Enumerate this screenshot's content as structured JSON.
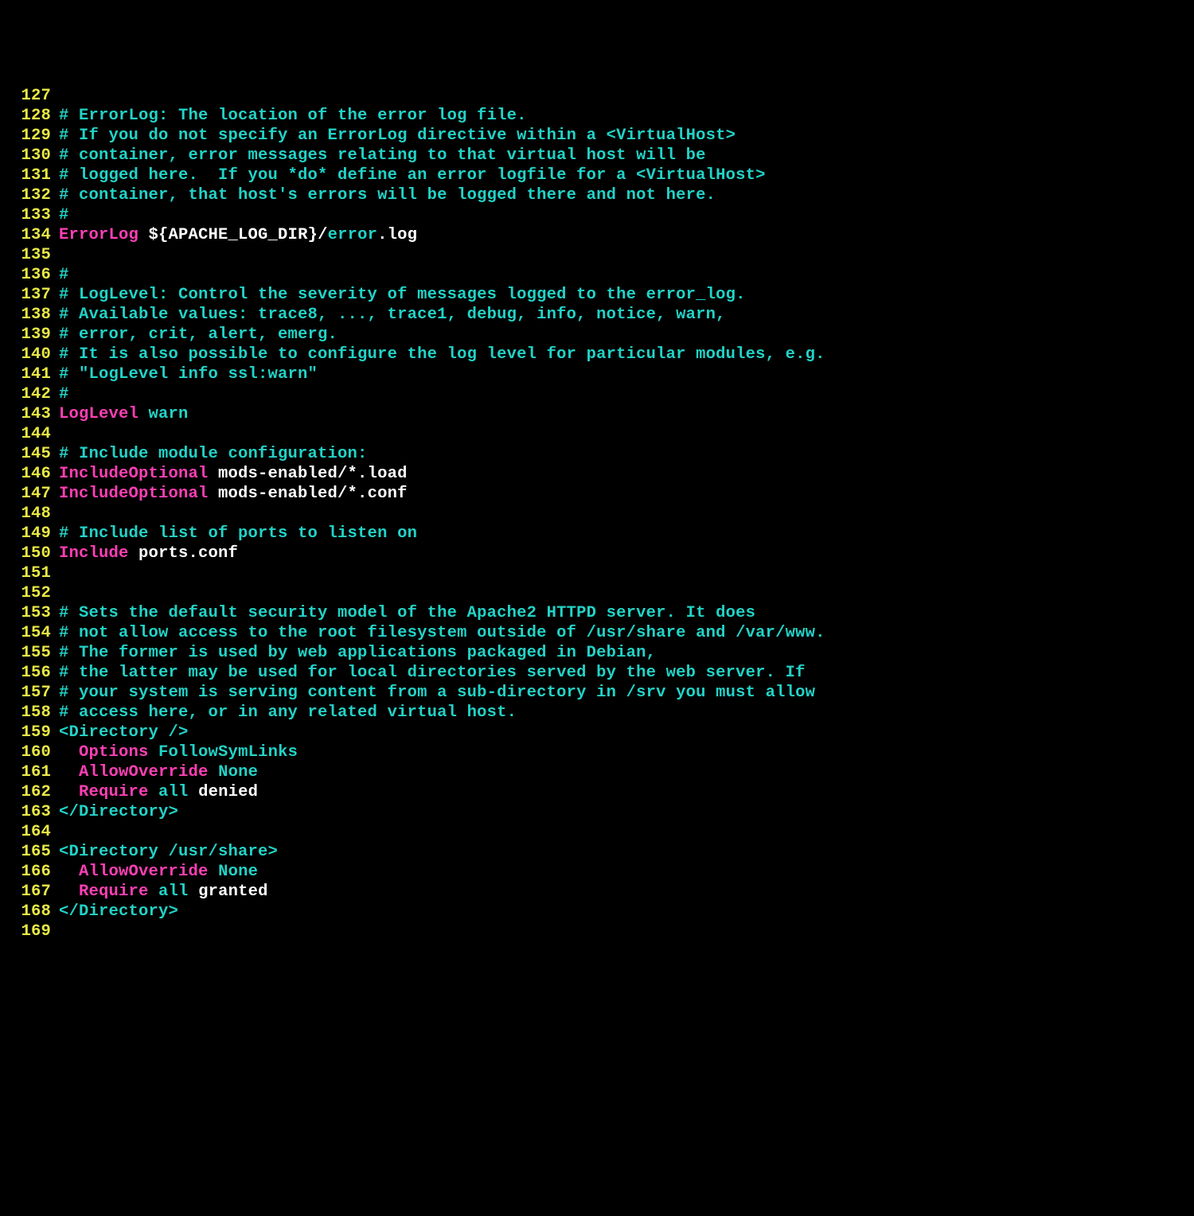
{
  "lines": [
    {
      "n": "127",
      "tokens": []
    },
    {
      "n": "128",
      "tokens": [
        {
          "c": "cm",
          "t": "# ErrorLog: The location of the error log file."
        }
      ]
    },
    {
      "n": "129",
      "tokens": [
        {
          "c": "cm",
          "t": "# If you do not specify an ErrorLog directive within a <VirtualHost>"
        }
      ]
    },
    {
      "n": "130",
      "tokens": [
        {
          "c": "cm",
          "t": "# container, error messages relating to that virtual host will be"
        }
      ]
    },
    {
      "n": "131",
      "tokens": [
        {
          "c": "cm",
          "t": "# logged here.  If you *do* define an error logfile for a <VirtualHost>"
        }
      ]
    },
    {
      "n": "132",
      "tokens": [
        {
          "c": "cm",
          "t": "# container, that host's errors will be logged there and not here."
        }
      ]
    },
    {
      "n": "133",
      "tokens": [
        {
          "c": "cm",
          "t": "#"
        }
      ]
    },
    {
      "n": "134",
      "tokens": [
        {
          "c": "dir",
          "t": "ErrorLog"
        },
        {
          "c": "var",
          "t": " ${APACHE_LOG_DIR}/"
        },
        {
          "c": "path",
          "t": "error"
        },
        {
          "c": "var",
          "t": ".log"
        }
      ]
    },
    {
      "n": "135",
      "tokens": []
    },
    {
      "n": "136",
      "tokens": [
        {
          "c": "cm",
          "t": "#"
        }
      ]
    },
    {
      "n": "137",
      "tokens": [
        {
          "c": "cm",
          "t": "# LogLevel: Control the severity of messages logged to the error_log."
        }
      ]
    },
    {
      "n": "138",
      "tokens": [
        {
          "c": "cm",
          "t": "# Available values: trace8, ..., trace1, debug, info, notice, warn,"
        }
      ]
    },
    {
      "n": "139",
      "tokens": [
        {
          "c": "cm",
          "t": "# error, crit, alert, emerg."
        }
      ]
    },
    {
      "n": "140",
      "tokens": [
        {
          "c": "cm",
          "t": "# It is also possible to configure the log level for particular modules, e.g."
        }
      ]
    },
    {
      "n": "141",
      "tokens": [
        {
          "c": "cm",
          "t": "# \"LogLevel info ssl:warn\""
        }
      ]
    },
    {
      "n": "142",
      "tokens": [
        {
          "c": "cm",
          "t": "#"
        }
      ]
    },
    {
      "n": "143",
      "tokens": [
        {
          "c": "dir",
          "t": "LogLevel"
        },
        {
          "c": "plain",
          "t": " "
        },
        {
          "c": "val",
          "t": "warn"
        }
      ]
    },
    {
      "n": "144",
      "tokens": []
    },
    {
      "n": "145",
      "tokens": [
        {
          "c": "cm",
          "t": "# Include module configuration:"
        }
      ]
    },
    {
      "n": "146",
      "tokens": [
        {
          "c": "dir",
          "t": "IncludeOptional"
        },
        {
          "c": "var",
          "t": " mods-enabled/*.load"
        }
      ]
    },
    {
      "n": "147",
      "tokens": [
        {
          "c": "dir",
          "t": "IncludeOptional"
        },
        {
          "c": "var",
          "t": " mods-enabled/*.conf"
        }
      ]
    },
    {
      "n": "148",
      "tokens": []
    },
    {
      "n": "149",
      "tokens": [
        {
          "c": "cm",
          "t": "# Include list of ports to listen on"
        }
      ]
    },
    {
      "n": "150",
      "tokens": [
        {
          "c": "dir",
          "t": "Include"
        },
        {
          "c": "var",
          "t": " ports.conf"
        }
      ]
    },
    {
      "n": "151",
      "tokens": []
    },
    {
      "n": "152",
      "tokens": []
    },
    {
      "n": "153",
      "tokens": [
        {
          "c": "cm",
          "t": "# Sets the default security model of the Apache2 HTTPD server. It does"
        }
      ]
    },
    {
      "n": "154",
      "tokens": [
        {
          "c": "cm",
          "t": "# not allow access to the root filesystem outside of /usr/share and /var/www."
        }
      ]
    },
    {
      "n": "155",
      "tokens": [
        {
          "c": "cm",
          "t": "# The former is used by web applications packaged in Debian,"
        }
      ]
    },
    {
      "n": "156",
      "tokens": [
        {
          "c": "cm",
          "t": "# the latter may be used for local directories served by the web server. If"
        }
      ]
    },
    {
      "n": "157",
      "tokens": [
        {
          "c": "cm",
          "t": "# your system is serving content from a sub-directory in /srv you must allow"
        }
      ]
    },
    {
      "n": "158",
      "tokens": [
        {
          "c": "cm",
          "t": "# access here, or in any related virtual host."
        }
      ]
    },
    {
      "n": "159",
      "tokens": [
        {
          "c": "tag",
          "t": "<Directory />"
        }
      ]
    },
    {
      "n": "160",
      "tokens": [
        {
          "c": "plain",
          "t": "  "
        },
        {
          "c": "dir",
          "t": "Options"
        },
        {
          "c": "plain",
          "t": " "
        },
        {
          "c": "val",
          "t": "FollowSymLinks"
        }
      ]
    },
    {
      "n": "161",
      "tokens": [
        {
          "c": "plain",
          "t": "  "
        },
        {
          "c": "dir",
          "t": "AllowOverride"
        },
        {
          "c": "plain",
          "t": " "
        },
        {
          "c": "none",
          "t": "None"
        }
      ]
    },
    {
      "n": "162",
      "tokens": [
        {
          "c": "plain",
          "t": "  "
        },
        {
          "c": "dir",
          "t": "Require"
        },
        {
          "c": "plain",
          "t": " "
        },
        {
          "c": "val",
          "t": "all"
        },
        {
          "c": "var",
          "t": " denied"
        }
      ]
    },
    {
      "n": "163",
      "tokens": [
        {
          "c": "tag",
          "t": "</Directory>"
        }
      ]
    },
    {
      "n": "164",
      "tokens": []
    },
    {
      "n": "165",
      "tokens": [
        {
          "c": "tag",
          "t": "<Directory /usr/share>"
        }
      ]
    },
    {
      "n": "166",
      "tokens": [
        {
          "c": "plain",
          "t": "  "
        },
        {
          "c": "dir",
          "t": "AllowOverride"
        },
        {
          "c": "plain",
          "t": " "
        },
        {
          "c": "none",
          "t": "None"
        }
      ]
    },
    {
      "n": "167",
      "tokens": [
        {
          "c": "plain",
          "t": "  "
        },
        {
          "c": "dir",
          "t": "Require"
        },
        {
          "c": "plain",
          "t": " "
        },
        {
          "c": "val",
          "t": "all"
        },
        {
          "c": "var",
          "t": " granted"
        }
      ]
    },
    {
      "n": "168",
      "tokens": [
        {
          "c": "tag",
          "t": "</Directory>"
        }
      ]
    },
    {
      "n": "169",
      "tokens": []
    }
  ]
}
